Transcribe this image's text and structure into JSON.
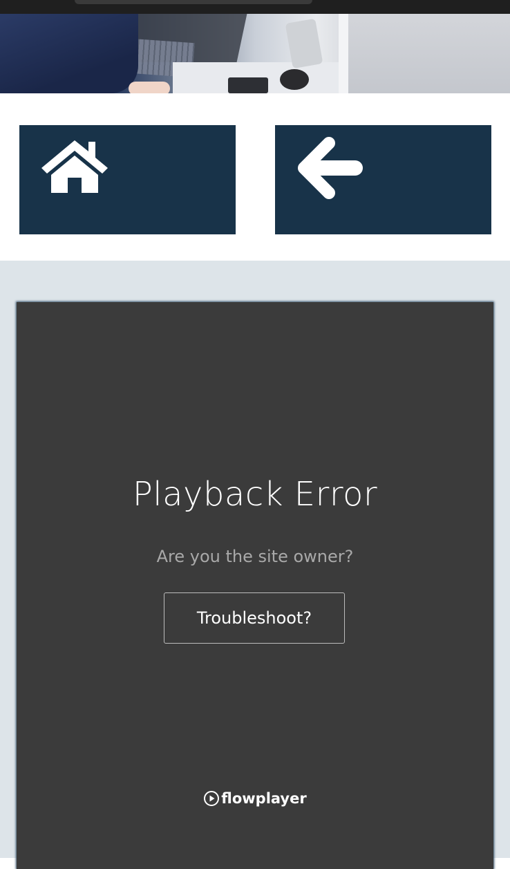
{
  "hero": {
    "image": "laptop-desk-photo"
  },
  "nav": {
    "home_icon": "home-icon",
    "back_icon": "arrow-left-icon",
    "button_color": "#183349"
  },
  "player": {
    "error_title": "Playback Error",
    "error_subtitle": "Are you the site owner?",
    "troubleshoot_label": "Troubleshoot?",
    "brand_name": "flowplayer",
    "brand_icon": "play-circle-icon",
    "background_color": "#3b3b3b"
  },
  "page": {
    "content_background": "#dde4e9"
  }
}
